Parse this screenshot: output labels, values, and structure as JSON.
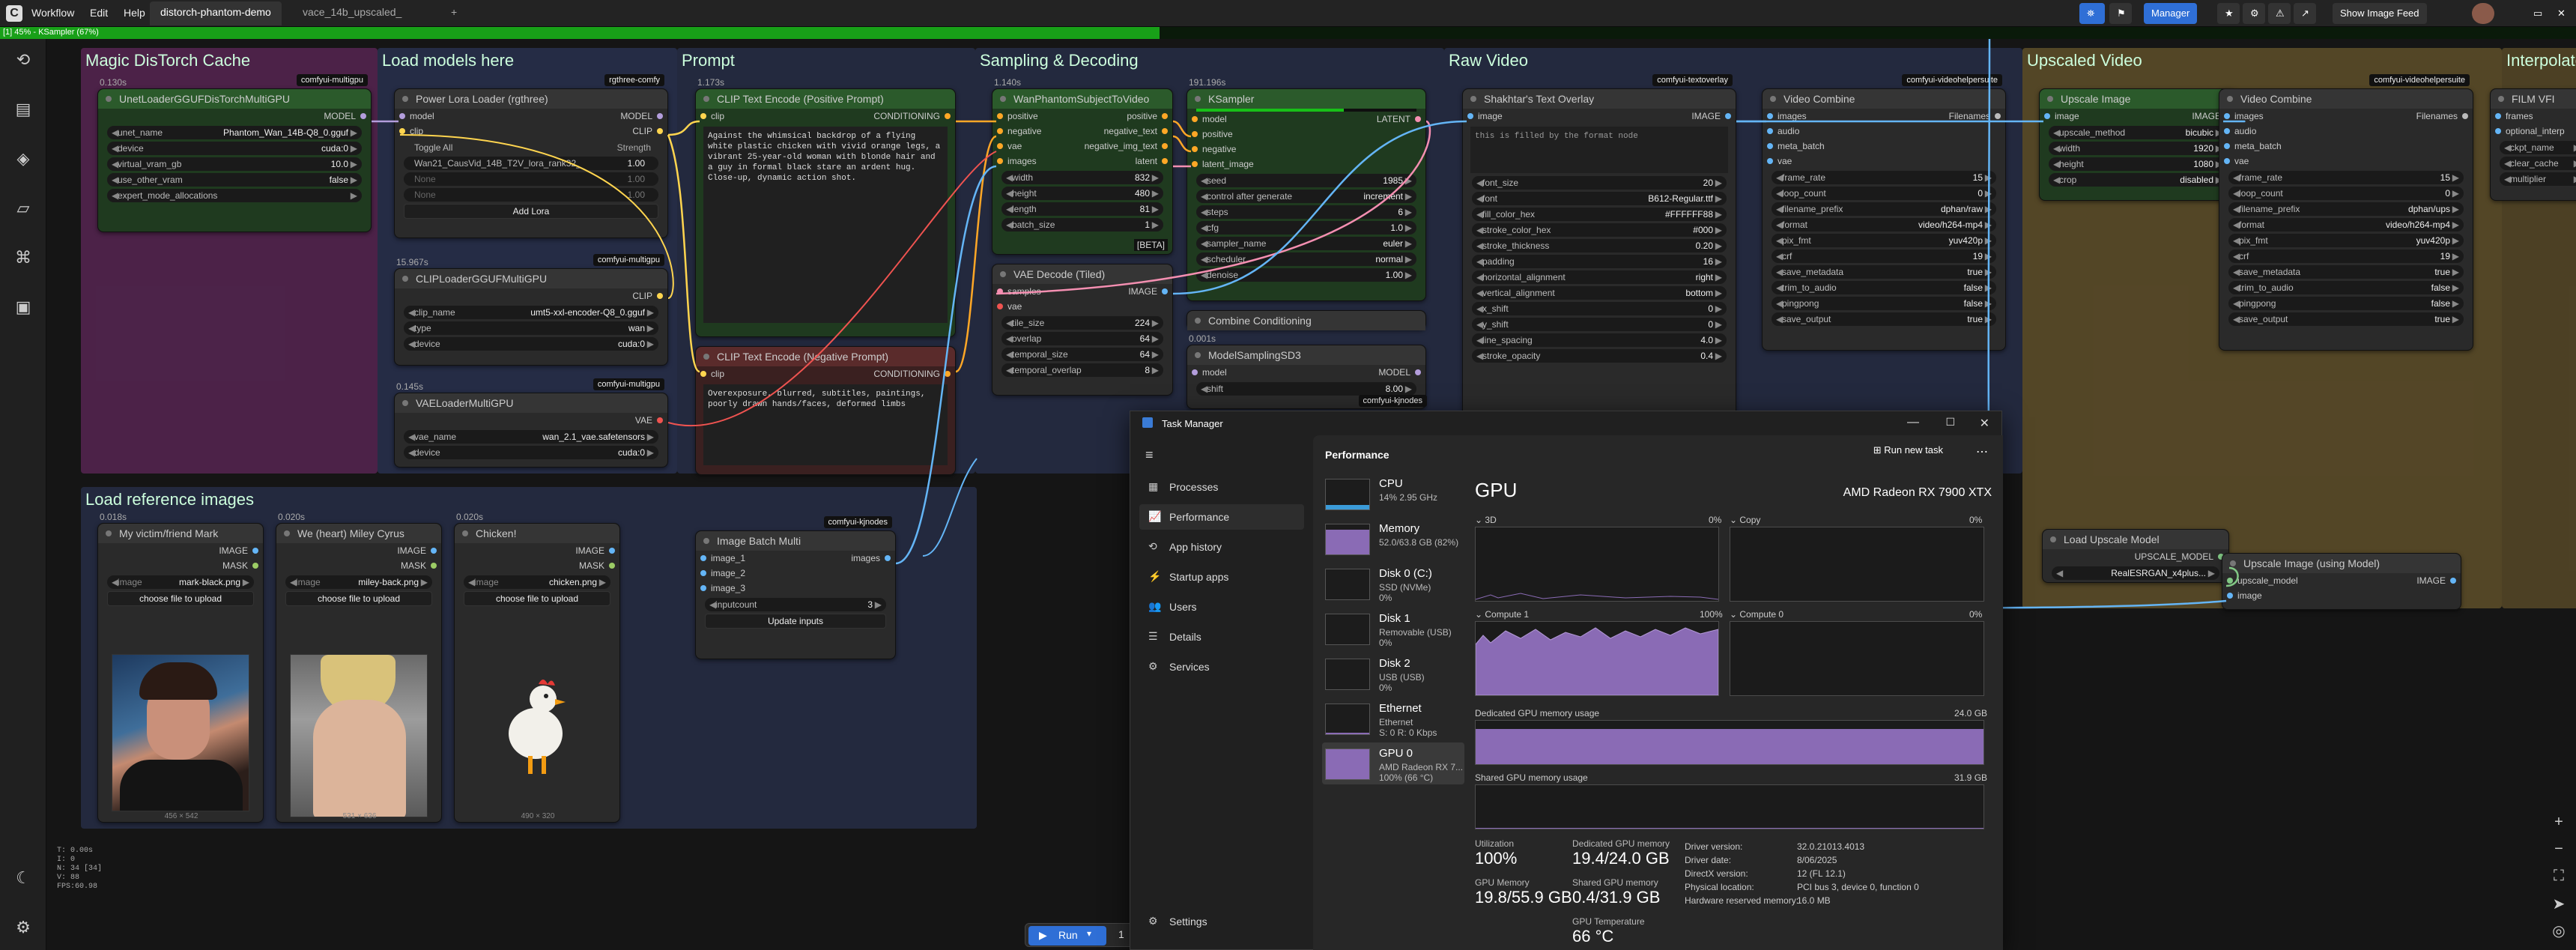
{
  "menubar": {
    "menus": [
      "Workflow",
      "Edit",
      "Help"
    ],
    "tabs": [
      "distorch-phantom-demo",
      "vace_14b_upscaled_"
    ],
    "new_tab": "+",
    "manager": "Manager",
    "image_feed": "Show Image Feed"
  },
  "progress": {
    "text": "[1] 45% - KSampler (67%)",
    "fraction": 0.45
  },
  "groups": {
    "g1": "Magic DisTorch Cache",
    "g2": "Load models here",
    "g3": "Prompt",
    "g4": "Sampling & Decoding",
    "g5": "Raw Video",
    "g6": "Upscaled Video",
    "g7": "Interpolated",
    "g8": "Load reference images"
  },
  "nodes": {
    "unet": {
      "time": "0.130s",
      "badge": "comfyui-multigpu",
      "title": "UnetLoaderGGUFDisTorchMultiGPU",
      "out": "MODEL",
      "w": [
        [
          "unet_name",
          "Phantom_Wan_14B-Q8_0.gguf"
        ],
        [
          "device",
          "cuda:0"
        ],
        [
          "virtual_vram_gb",
          "10.0"
        ],
        [
          "use_other_vram",
          "false"
        ],
        [
          "expert_mode_allocations",
          ""
        ]
      ]
    },
    "lora": {
      "badge": "rgthree-comfy",
      "title": "Power Lora Loader (rgthree)",
      "in1": "model",
      "in2": "clip",
      "out1": "MODEL",
      "out2": "CLIP",
      "toggle": "Toggle All",
      "strength": "Strength",
      "lora1": "Wan21_CausVid_14B_T2V_lora_rank32_",
      "lora1v": "1.00",
      "none": "None",
      "nonev": "1.00",
      "add": "Add Lora"
    },
    "clipload": {
      "time": "15.967s",
      "badge": "comfyui-multigpu",
      "title": "CLIPLoaderGGUFMultiGPU",
      "out": "CLIP",
      "w": [
        [
          "clip_name",
          "umt5-xxl-encoder-Q8_0.gguf"
        ],
        [
          "type",
          "wan"
        ],
        [
          "device",
          "cuda:0"
        ]
      ]
    },
    "vaeload": {
      "time": "0.145s",
      "badge": "comfyui-multigpu",
      "title": "VAELoaderMultiGPU",
      "out": "VAE",
      "w": [
        [
          "vae_name",
          "wan_2.1_vae.safetensors"
        ],
        [
          "device",
          "cuda:0"
        ]
      ]
    },
    "pos": {
      "time": "1.173s",
      "title": "CLIP Text Encode (Positive Prompt)",
      "in": "clip",
      "out": "CONDITIONING",
      "text": "Against the whimsical backdrop of a flying white plastic chicken with vivid orange legs, a vibrant 25-year-old woman with blonde hair and a guy in formal black stare an ardent hug. Close-up, dynamic action shot."
    },
    "neg": {
      "title": "CLIP Text Encode (Negative Prompt)",
      "in": "clip",
      "out": "CONDITIONING",
      "text": "Overexposure, blurred, subtitles, paintings, poorly drawn hands/faces, deformed limbs"
    },
    "phantom": {
      "time": "1.140s",
      "title": "WanPhantomSubjectToVideo",
      "ins": [
        "positive",
        "negative",
        "vae",
        "images"
      ],
      "outs": [
        "positive",
        "negative_text",
        "negative_img_text",
        "latent"
      ],
      "w": [
        [
          "width",
          "832"
        ],
        [
          "height",
          "480"
        ],
        [
          "length",
          "81"
        ],
        [
          "batch_size",
          "1"
        ]
      ],
      "beta": "[BETA]"
    },
    "vaedec": {
      "title": "VAE Decode (Tiled)",
      "ins": [
        "samples",
        "vae"
      ],
      "out": "IMAGE",
      "w": [
        [
          "tile_size",
          "224"
        ],
        [
          "overlap",
          "64"
        ],
        [
          "temporal_size",
          "64"
        ],
        [
          "temporal_overlap",
          "8"
        ]
      ]
    },
    "ksampler": {
      "time": "191.196s",
      "title": "KSampler",
      "ins": [
        "model",
        "positive",
        "negative",
        "latent_image"
      ],
      "out": "LATENT",
      "w": [
        [
          "seed",
          "1985"
        ],
        [
          "control after generate",
          "increment"
        ],
        [
          "steps",
          "6"
        ],
        [
          "cfg",
          "1.0"
        ],
        [
          "sampler_name",
          "euler"
        ],
        [
          "scheduler",
          "normal"
        ],
        [
          "denoise",
          "1.00"
        ]
      ]
    },
    "combine": {
      "title": "Combine Conditioning",
      "time": "0.001s"
    },
    "msd3": {
      "title": "ModelSamplingSD3",
      "in": "model",
      "out": "MODEL",
      "w": [
        [
          "shift",
          "8.00"
        ]
      ],
      "badge": "comfyui-kjnodes"
    },
    "overlay": {
      "badge": "comfyui-textoverlay",
      "title": "Shakhtar's Text Overlay",
      "in": "image",
      "out": "IMAGE",
      "text": "this is filled by the format node",
      "w": [
        [
          "font_size",
          "20"
        ],
        [
          "font",
          "B612-Regular.ttf"
        ],
        [
          "fill_color_hex",
          "#FFFFFF88"
        ],
        [
          "stroke_color_hex",
          "#000"
        ],
        [
          "stroke_thickness",
          "0.20"
        ],
        [
          "padding",
          "16"
        ],
        [
          "horizontal_alignment",
          "right"
        ],
        [
          "vertical_alignment",
          "bottom"
        ],
        [
          "x_shift",
          "0"
        ],
        [
          "y_shift",
          "0"
        ],
        [
          "line_spacing",
          "4.0"
        ],
        [
          "stroke_opacity",
          "0.4"
        ]
      ]
    },
    "vc1": {
      "badge": "comfyui-videohelpersuite",
      "title": "Video Combine",
      "ins": [
        "images",
        "audio",
        "meta_batch",
        "vae"
      ],
      "out": "Filenames",
      "w": [
        [
          "frame_rate",
          "15"
        ],
        [
          "loop_count",
          "0"
        ],
        [
          "filename_prefix",
          "dphan/raw"
        ],
        [
          "format",
          "video/h264-mp4"
        ],
        [
          "pix_fmt",
          "yuv420p"
        ],
        [
          "crf",
          "19"
        ],
        [
          "save_metadata",
          "true"
        ],
        [
          "trim_to_audio",
          "false"
        ],
        [
          "pingpong",
          "false"
        ],
        [
          "save_output",
          "true"
        ]
      ]
    },
    "upscale": {
      "title": "Upscale Image",
      "in": "image",
      "out": "IMAGE",
      "w": [
        [
          "upscale_method",
          "bicubic"
        ],
        [
          "width",
          "1920"
        ],
        [
          "height",
          "1080"
        ],
        [
          "crop",
          "disabled"
        ]
      ]
    },
    "vc2": {
      "badge": "comfyui-videohelpersuite",
      "title": "Video Combine",
      "ins": [
        "images",
        "audio",
        "meta_batch",
        "vae"
      ],
      "out": "Filenames",
      "w": [
        [
          "frame_rate",
          "15"
        ],
        [
          "loop_count",
          "0"
        ],
        [
          "filename_prefix",
          "dphan/ups"
        ],
        [
          "format",
          "video/h264-mp4"
        ],
        [
          "pix_fmt",
          "yuv420p"
        ],
        [
          "crf",
          "19"
        ],
        [
          "save_metadata",
          "true"
        ],
        [
          "trim_to_audio",
          "false"
        ],
        [
          "pingpong",
          "false"
        ],
        [
          "save_output",
          "true"
        ]
      ]
    },
    "film": {
      "title": "FILM VFI",
      "ins": [
        "frames",
        "optional_interp"
      ],
      "w": [
        [
          "ckpt_name",
          ""
        ],
        [
          "clear_cache",
          ""
        ],
        [
          "multiplier",
          ""
        ]
      ]
    },
    "lum": {
      "title": "Load Upscale Model",
      "out": "UPSCALE_MODEL",
      "w": [
        [
          "",
          "RealESRGAN_x4plus..."
        ]
      ]
    },
    "uium": {
      "title": "Upscale Image (using Model)",
      "ins": [
        "upscale_model",
        "image"
      ],
      "out": "IMAGE"
    },
    "img1": {
      "time": "0.018s",
      "title": "My victim/friend Mark",
      "outs": [
        "IMAGE",
        "MASK"
      ],
      "file": "mark-black.png",
      "upload": "choose file to upload",
      "dim": "456 × 542"
    },
    "img2": {
      "time": "0.020s",
      "title": "We (heart) Miley Cyrus",
      "outs": [
        "IMAGE",
        "MASK"
      ],
      "file": "miley-back.png",
      "upload": "choose file to upload",
      "dim": "531 × 636"
    },
    "img3": {
      "time": "0.020s",
      "title": "Chicken!",
      "outs": [
        "IMAGE",
        "MASK"
      ],
      "file": "chicken.png",
      "upload": "choose file to upload",
      "dim": "490 × 320"
    },
    "batch": {
      "badge": "comfyui-kjnodes",
      "title": "Image Batch Multi",
      "ins": [
        "image_1",
        "image_2",
        "image_3"
      ],
      "out": "images",
      "w": [
        [
          "inputcount",
          "3"
        ]
      ],
      "btn": "Update inputs"
    }
  },
  "taskmanager": {
    "title": "Task Manager",
    "nav": [
      "Processes",
      "Performance",
      "App history",
      "Startup apps",
      "Users",
      "Details",
      "Services"
    ],
    "settings": "Settings",
    "header": "Performance",
    "run_new": "Run new task",
    "devices": [
      {
        "name": "CPU",
        "s1": "14% 2.95 GHz",
        "s2": ""
      },
      {
        "name": "Memory",
        "s1": "52.0/63.8 GB (82%)",
        "s2": ""
      },
      {
        "name": "Disk 0 (C:)",
        "s1": "SSD (NVMe)",
        "s2": "0%"
      },
      {
        "name": "Disk 1",
        "s1": "Removable (USB)",
        "s2": "0%"
      },
      {
        "name": "Disk 2",
        "s1": "USB (USB)",
        "s2": "0%"
      },
      {
        "name": "Ethernet",
        "s1": "Ethernet",
        "s2": "S: 0 R: 0 Kbps"
      },
      {
        "name": "GPU 0",
        "s1": "AMD Radeon RX 7...",
        "s2": "100% (66 °C)"
      }
    ],
    "gpu_title": "GPU",
    "gpu_model": "AMD Radeon RX 7900 XTX",
    "g3d": "3D",
    "g3d_pct": "0%",
    "gcopy": "Copy",
    "gcopy_pct": "0%",
    "gcompute1": "Compute 1",
    "gcompute1_pct": "100%",
    "gcompute0": "Compute 0",
    "gcompute0_pct": "0%",
    "ded_label": "Dedicated GPU memory usage",
    "ded_max": "24.0 GB",
    "shared_label": "Shared GPU memory usage",
    "shared_max": "31.9 GB",
    "stats": [
      {
        "k": "Utilization",
        "v": "100%"
      },
      {
        "k": "Dedicated GPU memory",
        "v": "19.4/24.0 GB"
      },
      {
        "k": "GPU Memory",
        "v": "19.8/55.9 GB"
      },
      {
        "k": "Shared GPU memory",
        "v": "0.4/31.9 GB"
      },
      {
        "k": "GPU Temperature",
        "v": "66 °C"
      }
    ],
    "details": [
      [
        "Driver version:",
        "32.0.21013.4013"
      ],
      [
        "Driver date:",
        "8/06/2025"
      ],
      [
        "DirectX version:",
        "12 (FL 12.1)"
      ],
      [
        "Physical location:",
        "PCI bus 3, device 0, function 0"
      ],
      [
        "Hardware reserved memory:",
        "16.0 MB"
      ]
    ]
  },
  "run": {
    "label": "Run",
    "count": "1"
  },
  "canvas_stats": "T: 0.00s\nI: 0\nN: 34 [34]\nV: 88\nFPS:60.98",
  "colors": {
    "accent": "#2f6fd6",
    "progress": "#18a018",
    "gpu_fill": "#8a6bb5"
  }
}
